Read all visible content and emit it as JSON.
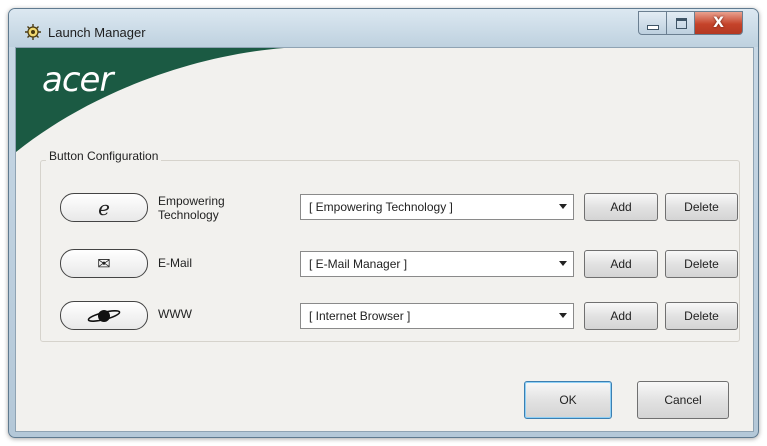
{
  "window": {
    "title": "Launch Manager",
    "minimize_label": "",
    "close_glyph": "X"
  },
  "brand": {
    "logo_text": "acer",
    "banner_color": "#1b5a43"
  },
  "group": {
    "label": "Button Configuration"
  },
  "rows": [
    {
      "icon": "ie-e-icon",
      "icon_glyph": "e",
      "label_line1": "Empowering",
      "label_line2": "Technology",
      "selected": "[ Empowering Technology ]",
      "add_label": "Add",
      "delete_label": "Delete"
    },
    {
      "icon": "envelope-icon",
      "icon_glyph": "✉",
      "label_line1": "E-Mail",
      "label_line2": "",
      "selected": "[ E-Mail Manager ]",
      "add_label": "Add",
      "delete_label": "Delete"
    },
    {
      "icon": "planet-icon",
      "icon_glyph": "",
      "label_line1": "WWW",
      "label_line2": "",
      "selected": "[ Internet Browser ]",
      "add_label": "Add",
      "delete_label": "Delete"
    }
  ],
  "footer": {
    "ok_label": "OK",
    "cancel_label": "Cancel"
  },
  "colors": {
    "banner": "#1b5a43",
    "client_bg": "#f2f1ee",
    "close_button": "#c5432a"
  }
}
